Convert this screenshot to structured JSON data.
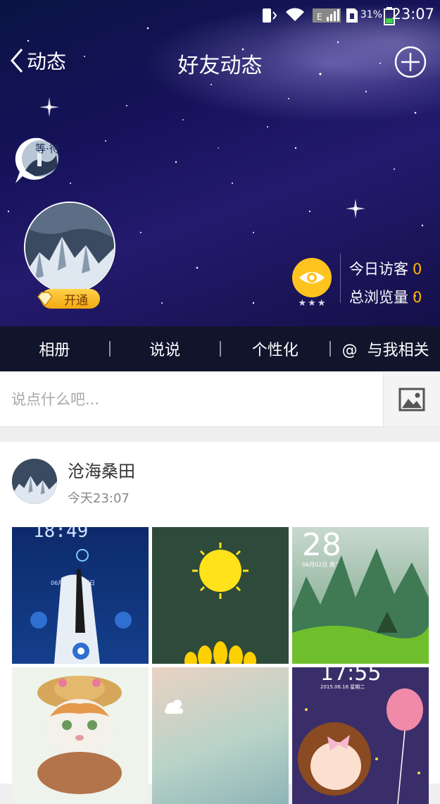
{
  "status_bar": {
    "battery_percent": "31%",
    "time": "23:07",
    "signal_label": "E"
  },
  "nav": {
    "back_label": "动态",
    "title": "好友动态"
  },
  "profile": {
    "sticker_text": "等·待",
    "vip_label": "开通",
    "rating_stars": "★★★",
    "today_visitors_label": "今日访客",
    "today_visitors_value": "0",
    "total_views_label": "总浏览量",
    "total_views_value": "0"
  },
  "tabs": [
    {
      "label": "相册"
    },
    {
      "label": "说说"
    },
    {
      "label": "个性化"
    },
    {
      "label": "与我相关",
      "prefix": "@"
    }
  ],
  "composer": {
    "placeholder": "说点什么吧..."
  },
  "feed": {
    "author": "沧海桑田",
    "time": "今天23:07",
    "photos": [
      {
        "screen_time": "18:49",
        "screen_date": "06月07日 星期日"
      },
      {},
      {
        "screen_time": "28",
        "screen_date": "06月02日 周二"
      },
      {},
      {},
      {
        "screen_time": "17:55",
        "screen_date": "2015.06.16 星期二"
      }
    ]
  },
  "colors": {
    "accent_orange": "#ffb400",
    "eye_button": "#ffc31f",
    "tab_bar_bg": "#11152c"
  }
}
